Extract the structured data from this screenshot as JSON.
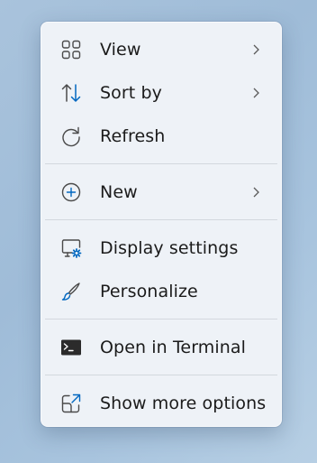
{
  "menu": {
    "items": [
      {
        "label": "View",
        "icon": "view-grid-icon",
        "has_submenu": true
      },
      {
        "label": "Sort by",
        "icon": "sort-arrows-icon",
        "has_submenu": true
      },
      {
        "label": "Refresh",
        "icon": "refresh-icon",
        "has_submenu": false
      },
      {
        "label": "New",
        "icon": "plus-circle-icon",
        "has_submenu": true
      },
      {
        "label": "Display settings",
        "icon": "display-settings-icon",
        "has_submenu": false
      },
      {
        "label": "Personalize",
        "icon": "brush-icon",
        "has_submenu": false
      },
      {
        "label": "Open in Terminal",
        "icon": "terminal-icon",
        "has_submenu": false
      },
      {
        "label": "Show more options",
        "icon": "share-external-icon",
        "has_submenu": false
      }
    ]
  },
  "colors": {
    "accent": "#0067c0",
    "menu_background": "#eef2f7",
    "desktop_background": "#a9c3dc",
    "text": "#1b1b1b",
    "separator": "#d3d8de"
  }
}
